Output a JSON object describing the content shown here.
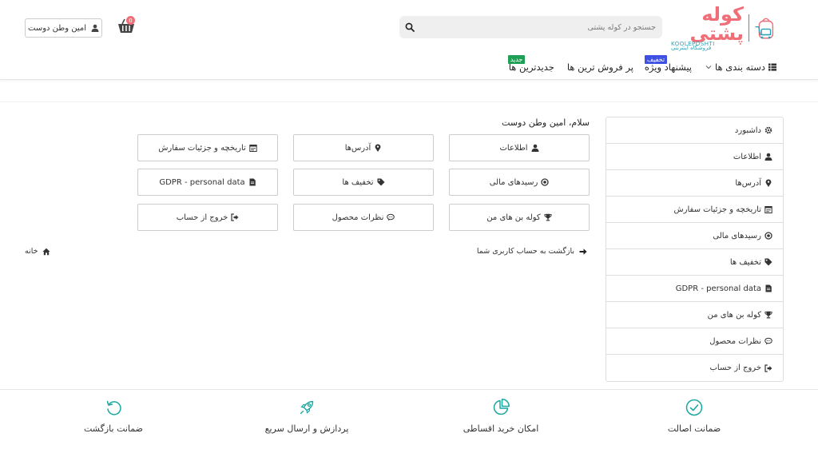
{
  "brand": {
    "name_fa": "کوله پشتی",
    "name_en": "KOOLEPOSHTI",
    "tagline": "فروشگاه اینترنتی"
  },
  "search": {
    "placeholder": "جستجو در کوله پشتی"
  },
  "cart": {
    "count": "0"
  },
  "user": {
    "name": "امین وطن دوست"
  },
  "nav": {
    "categories": "دسته بندی ها",
    "special_offer": "پیشنهاد ویژه",
    "special_tag": "تخفیف",
    "best_sellers": "پر فروش ترین ها",
    "newest": "جدیدترین ها",
    "newest_tag": "جدید"
  },
  "sidebar": {
    "items": [
      {
        "label": "داشبورد",
        "icon": "gear-icon"
      },
      {
        "label": "اطلاعات",
        "icon": "user-icon"
      },
      {
        "label": "آدرس‌ها",
        "icon": "map-marker-icon"
      },
      {
        "label": "تاریخچه و جزئیات سفارش",
        "icon": "calendar-icon"
      },
      {
        "label": "رسیدهای مالی",
        "icon": "circle-dot-icon"
      },
      {
        "label": "تخفیف ها",
        "icon": "tag-icon"
      },
      {
        "label": "GDPR - personal data",
        "icon": "file-icon"
      },
      {
        "label": "کوله بن های من",
        "icon": "trophy-icon"
      },
      {
        "label": "نظرات محصول",
        "icon": "comment-icon"
      },
      {
        "label": "خروج از حساب",
        "icon": "sign-out-icon"
      }
    ]
  },
  "main": {
    "greeting": "سلام، امین وطن دوست",
    "tiles": [
      {
        "label": "اطلاعات",
        "icon": "user-icon"
      },
      {
        "label": "آدرس‌ها",
        "icon": "map-marker-icon"
      },
      {
        "label": "تاریخچه و جزئیات سفارش",
        "icon": "calendar-icon"
      },
      {
        "label": "رسیدهای مالی",
        "icon": "circle-dot-icon"
      },
      {
        "label": "تخفیف ها",
        "icon": "tag-icon"
      },
      {
        "label": "GDPR - personal data",
        "icon": "file-icon"
      },
      {
        "label": "کوله بن های من",
        "icon": "trophy-icon"
      },
      {
        "label": "نظرات محصول",
        "icon": "comment-icon"
      },
      {
        "label": "خروج از حساب",
        "icon": "sign-out-icon"
      }
    ],
    "back_link": "بازگشت به حساب کاربری شما",
    "home_link": "خانه"
  },
  "features": [
    {
      "label": "ضمانت اصالت",
      "icon": "check-circle-icon"
    },
    {
      "label": "امکان خرید اقساطی",
      "icon": "pie-chart-icon"
    },
    {
      "label": "پردازش و ارسال سریع",
      "icon": "rocket-icon"
    },
    {
      "label": "ضمانت بازگشت",
      "icon": "undo-icon"
    }
  ],
  "colors": {
    "brand_pink": "#f06e78",
    "brand_teal": "#29a3b8",
    "tag_blue": "#3f51e3",
    "tag_green": "#1f9f55",
    "feature_teal": "#1aa7a0"
  }
}
